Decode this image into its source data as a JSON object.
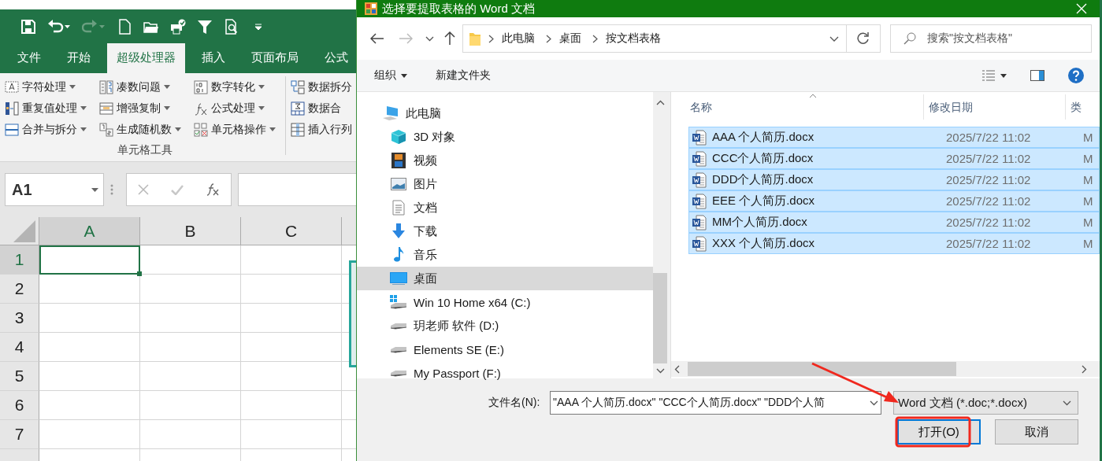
{
  "excel": {
    "quick_access": [
      {
        "kind": "save",
        "disabled": false
      },
      {
        "kind": "undo",
        "disabled": false
      },
      {
        "kind": "redo",
        "disabled": true
      },
      {
        "kind": "new",
        "disabled": false
      },
      {
        "kind": "open",
        "disabled": false
      },
      {
        "kind": "print",
        "disabled": false
      },
      {
        "kind": "filter",
        "disabled": false
      },
      {
        "kind": "preview",
        "disabled": false
      },
      {
        "kind": "customize",
        "disabled": false
      }
    ],
    "tabs": [
      {
        "label": "文件",
        "selected": false
      },
      {
        "label": "开始",
        "selected": false
      },
      {
        "label": "超级处理器",
        "selected": true
      },
      {
        "label": "插入",
        "selected": false
      },
      {
        "label": "页面布局",
        "selected": false
      },
      {
        "label": "公式",
        "selected": false
      }
    ],
    "ribbon": {
      "groups": [
        {
          "label": "单元格工具",
          "buttons": [
            {
              "label": "字符处理",
              "dropdown": true
            },
            {
              "label": "凑数问题",
              "dropdown": true
            },
            {
              "label": "数字转化",
              "dropdown": true
            },
            {
              "label": "重复值处理",
              "dropdown": true
            },
            {
              "label": "增强复制",
              "dropdown": true
            },
            {
              "label": "公式处理",
              "dropdown": true
            },
            {
              "label": "合并与拆分",
              "dropdown": true
            },
            {
              "label": "生成随机数",
              "dropdown": true
            },
            {
              "label": "单元格操作",
              "dropdown": true
            }
          ]
        },
        {
          "buttons": [
            {
              "label": "数据拆分",
              "dropdown": false
            },
            {
              "label": "数据合",
              "dropdown": false
            },
            {
              "label": "插入行列",
              "dropdown": false
            }
          ]
        }
      ]
    },
    "name_box": "A1",
    "columns": [
      {
        "label": "A",
        "selected": true
      },
      {
        "label": "B",
        "selected": false
      },
      {
        "label": "C",
        "selected": false
      }
    ],
    "rows": [
      {
        "label": "1",
        "selected": true
      },
      {
        "label": "2",
        "selected": false
      },
      {
        "label": "3",
        "selected": false
      },
      {
        "label": "4",
        "selected": false
      },
      {
        "label": "5",
        "selected": false
      },
      {
        "label": "6",
        "selected": false
      },
      {
        "label": "7",
        "selected": false
      }
    ]
  },
  "dialog": {
    "title": "选择要提取表格的 Word 文档",
    "breadcrumb": [
      "此电脑",
      "桌面",
      "按文档表格"
    ],
    "search": {
      "placeholder": "搜索\"按文档表格\""
    },
    "toolbar": {
      "organize": "组织",
      "new_folder": "新建文件夹"
    },
    "nav_tree": [
      {
        "label": "此电脑",
        "kind": "pc",
        "selected": false,
        "children": [
          {
            "label": "3D 对象",
            "kind": "cube",
            "selected": false
          },
          {
            "label": "视频",
            "kind": "video",
            "selected": false
          },
          {
            "label": "图片",
            "kind": "pictures",
            "selected": false
          },
          {
            "label": "文档",
            "kind": "documents",
            "selected": false
          },
          {
            "label": "下载",
            "kind": "downloads",
            "selected": false
          },
          {
            "label": "音乐",
            "kind": "music",
            "selected": false
          },
          {
            "label": "桌面",
            "kind": "desktop",
            "selected": true
          },
          {
            "label": "Win 10 Home x64 (C:)",
            "kind": "systemdrive",
            "selected": false
          },
          {
            "label": "玥老师 软件 (D:)",
            "kind": "drive",
            "selected": false
          },
          {
            "label": "Elements SE (E:)",
            "kind": "drive",
            "selected": false
          },
          {
            "label": "My Passport (F:)",
            "kind": "drive",
            "selected": false
          }
        ]
      }
    ],
    "file_list": {
      "columns": [
        "名称",
        "修改日期",
        "类"
      ],
      "rows": [
        {
          "name": "AAA 个人简历.docx",
          "modified": "2025/7/22 11:02",
          "column_3": "M",
          "selected": true
        },
        {
          "name": "CCC个人简历.docx",
          "modified": "2025/7/22 11:02",
          "column_3": "M",
          "selected": true
        },
        {
          "name": "DDD个人简历.docx",
          "modified": "2025/7/22 11:02",
          "column_3": "M",
          "selected": true
        },
        {
          "name": "EEE 个人简历.docx",
          "modified": "2025/7/22 11:02",
          "column_3": "M",
          "selected": true
        },
        {
          "name": "MM个人简历.docx",
          "modified": "2025/7/22 11:02",
          "column_3": "M",
          "selected": true
        },
        {
          "name": "XXX 个人简历.docx",
          "modified": "2025/7/22 11:02",
          "column_3": "M",
          "selected": true
        }
      ]
    },
    "file_name": {
      "label": "文件名(N):",
      "value": "\"AAA 个人简历.docx\" \"CCC个人简历.docx\" \"DDD个人简"
    },
    "file_type": "Word 文档 (*.doc;*.docx)",
    "buttons": [
      {
        "label": "打开(O)",
        "kind": "primary"
      },
      {
        "label": "取消",
        "kind": "secondary"
      }
    ]
  }
}
